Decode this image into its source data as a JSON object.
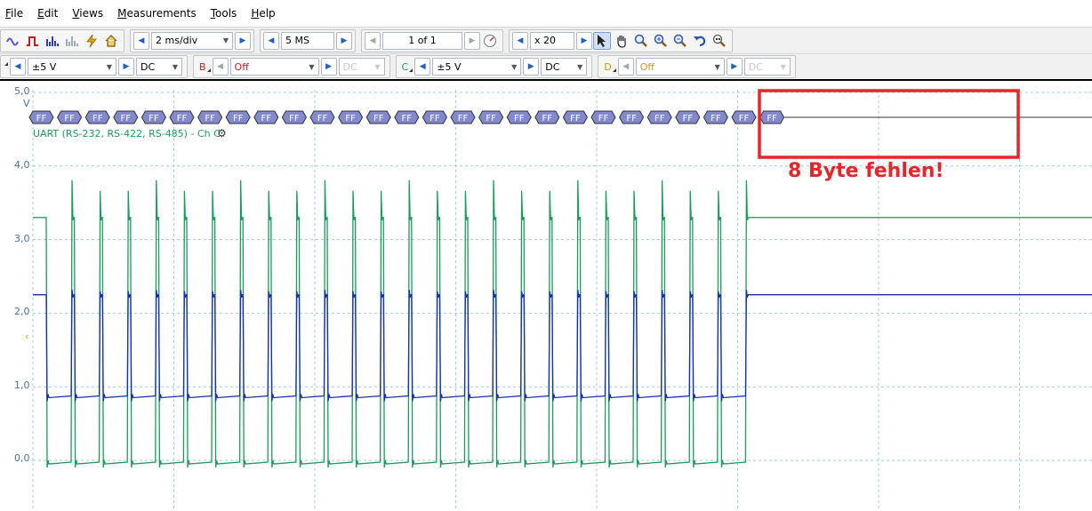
{
  "menu": [
    "File",
    "Edit",
    "Views",
    "Measurements",
    "Tools",
    "Help"
  ],
  "toolbar": {
    "timebase": "2 ms/div",
    "samples": "5 MS",
    "buffer": "1 of 1",
    "zoom": "x 20"
  },
  "channels": {
    "a": {
      "range": "±5 V",
      "coupling": "DC"
    },
    "b": {
      "label": "B",
      "range": "Off",
      "coupling": "DC",
      "enabled": false
    },
    "c": {
      "label": "C",
      "range": "±5 V",
      "coupling": "DC"
    },
    "d": {
      "label": "D",
      "range": "Off",
      "coupling": "DC",
      "enabled": false
    }
  },
  "plot": {
    "y_unit": "V",
    "y_ticks": [
      "5,0",
      "4,0",
      "3,0",
      "2,0",
      "1,0",
      "0,0"
    ],
    "decoder_label": "UART (RS-232, RS-422, RS-485) - Ch C",
    "byte_value": "FF",
    "byte_count": 27,
    "annotation": "8 Byte fehlen!",
    "colors": {
      "green": "#1a9c5a",
      "blue": "#1a2fb0",
      "annotation": "#e8262a",
      "byte_fill": "#8289cc"
    }
  },
  "chart_data": {
    "type": "line",
    "ylim": [
      0,
      5
    ],
    "series": [
      {
        "name": "",
        "color": "#1a9c5a",
        "high": 3.3,
        "low": 0.0,
        "pulses": 25
      },
      {
        "name": "",
        "color": "#1a2fb0",
        "high": 2.25,
        "low": 0.9,
        "pulses": 25
      }
    ]
  }
}
